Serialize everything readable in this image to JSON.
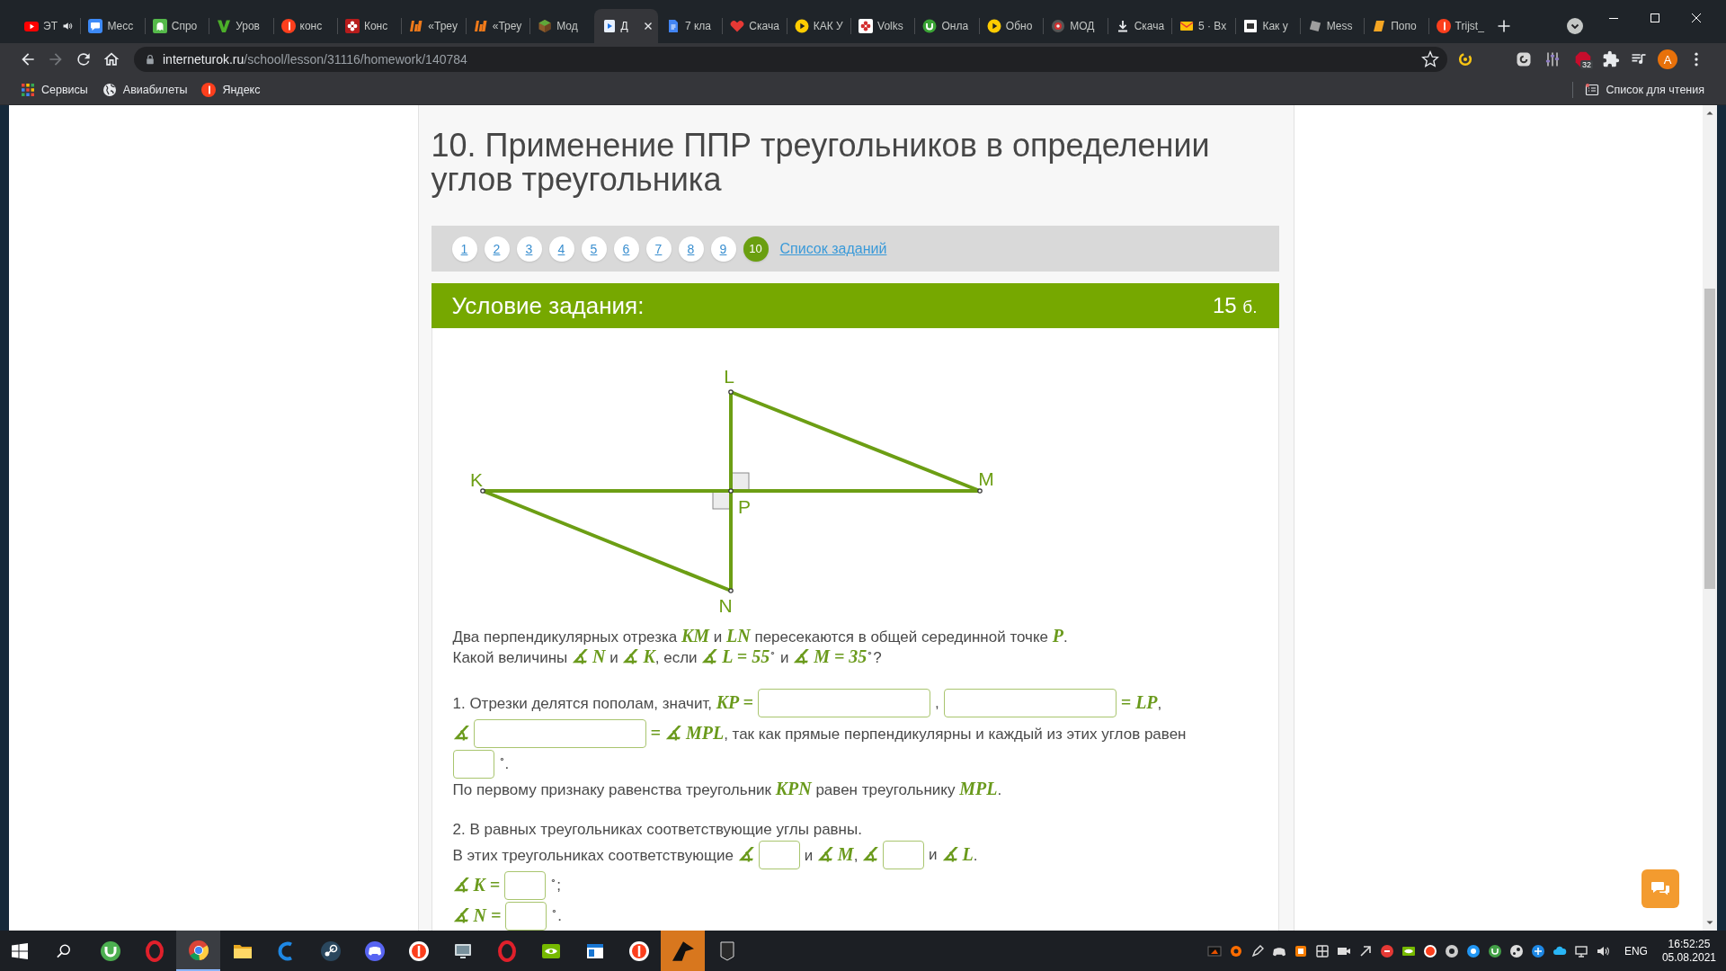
{
  "browser": {
    "tabs": [
      {
        "title": "ЭТ",
        "audio": true,
        "selected": false
      },
      {
        "title": "Месс",
        "audio": false,
        "selected": false
      },
      {
        "title": "Спро",
        "audio": false,
        "selected": false
      },
      {
        "title": "Уров",
        "audio": false,
        "selected": false
      },
      {
        "title": "конс",
        "audio": false,
        "selected": false
      },
      {
        "title": "Конс",
        "audio": false,
        "selected": false
      },
      {
        "title": "«Треу",
        "audio": false,
        "selected": false
      },
      {
        "title": "«Треу",
        "audio": false,
        "selected": false
      },
      {
        "title": "Мод",
        "audio": false,
        "selected": false
      },
      {
        "title": "Д",
        "audio": false,
        "selected": true
      },
      {
        "title": "7 кла",
        "audio": false,
        "selected": false
      },
      {
        "title": "Скача",
        "audio": false,
        "selected": false
      },
      {
        "title": "КАК У",
        "audio": false,
        "selected": false
      },
      {
        "title": "Volks",
        "audio": false,
        "selected": false
      },
      {
        "title": "Онла",
        "audio": false,
        "selected": false
      },
      {
        "title": "Обно",
        "audio": false,
        "selected": false
      },
      {
        "title": "МОД",
        "audio": false,
        "selected": false
      },
      {
        "title": "Скача",
        "audio": false,
        "selected": false
      },
      {
        "title": "5 · Вх",
        "audio": false,
        "selected": false
      },
      {
        "title": "Как у",
        "audio": false,
        "selected": false
      },
      {
        "title": "Mess",
        "audio": false,
        "selected": false
      },
      {
        "title": "Попо",
        "audio": false,
        "selected": false
      },
      {
        "title": "Trijst_",
        "audio": false,
        "selected": false
      }
    ],
    "nav": {
      "back_disabled": false,
      "forward_disabled": true
    },
    "url_host": "interneturok.ru",
    "url_path": "/school/lesson/31116/homework/140784",
    "extension_badge": "32",
    "profile_initial": "A",
    "bookmarks": [
      {
        "label": "Сервисы"
      },
      {
        "label": "Авиабилеты"
      },
      {
        "label": "Яндекс"
      }
    ],
    "reading_list": "Список для чтения"
  },
  "page": {
    "title": "10. Применение ППР треугольников в определении углов треугольника",
    "task_nav": [
      {
        "label": "1",
        "selected": false
      },
      {
        "label": "2",
        "selected": false
      },
      {
        "label": "3",
        "selected": false
      },
      {
        "label": "4",
        "selected": false
      },
      {
        "label": "5",
        "selected": false
      },
      {
        "label": "6",
        "selected": false
      },
      {
        "label": "7",
        "selected": false
      },
      {
        "label": "8",
        "selected": false
      },
      {
        "label": "9",
        "selected": false
      },
      {
        "label": "10",
        "selected": true
      }
    ],
    "task_list_link": "Список заданий",
    "task_header": {
      "title": "Условие задания:",
      "points": "15",
      "points_unit": "б."
    },
    "figure": {
      "points": [
        {
          "label": "L"
        },
        {
          "label": "K"
        },
        {
          "label": "M"
        },
        {
          "label": "P"
        },
        {
          "label": "N"
        }
      ]
    },
    "statement": [
      "Два перпендикулярных отрезка *KM* и *LN* пересекаются в общей серединной точке *P*.",
      "Какой величины *∡ N* и *∡ K*, если *∡ L = 55*$^{∘}$ и *∡ M = 35*$^{∘}$?"
    ],
    "questions": [
      {
        "lines": [
          {
            "parts": [
              {
                "kind": "text",
                "text": "1. Отрезки делятся пополам, значит, *KP =*"
              },
              {
                "kind": "long_field"
              },
              {
                "kind": "text",
                "text": ","
              },
              {
                "kind": "long_field"
              },
              {
                "kind": "text",
                "text": "*= LP*,"
              }
            ]
          },
          {
            "parts": [
              {
                "kind": "text",
                "text": "*∡*"
              },
              {
                "kind": "long_field"
              },
              {
                "kind": "text",
                "text": "*= ∡ MPL*, так как прямые перпендикулярны и каждый из этих углов равен"
              }
            ]
          },
          {
            "parts": [
              {
                "kind": "short_field"
              },
              {
                "kind": "text",
                "text": "$^{∘}$."
              }
            ]
          },
          {
            "parts": [
              {
                "kind": "text",
                "text": "По первому признаку равенства треугольник *KPN* равен треугольнику *MPL*."
              }
            ]
          }
        ]
      },
      {
        "lines": [
          {
            "parts": [
              {
                "kind": "text",
                "text": "2. В равных треугольниках соответствующие углы равны."
              }
            ]
          },
          {
            "parts": [
              {
                "kind": "text",
                "text": "В этих треугольниках соответствующие *∡*"
              },
              {
                "kind": "short_field"
              },
              {
                "kind": "text",
                "text": "и *∡ M*, *∡*"
              },
              {
                "kind": "short_field"
              },
              {
                "kind": "text",
                "text": "и"
              },
              {
                "kind": "text",
                "text": "*∡ L*."
              }
            ]
          },
          {
            "parts": [
              {
                "kind": "text",
                "text": "*∡ K =*"
              },
              {
                "kind": "short_field"
              },
              {
                "kind": "text",
                "text": "$^{∘}$;"
              }
            ]
          },
          {
            "parts": [
              {
                "kind": "text",
                "text": "*∡ N =*"
              },
              {
                "kind": "short_field"
              },
              {
                "kind": "text",
                "text": "$^{∘}$."
              }
            ]
          }
        ]
      }
    ]
  },
  "taskbar": {
    "apps": [
      {
        "selected": false,
        "attention": false
      },
      {
        "selected": false,
        "attention": false
      },
      {
        "selected": true,
        "attention": false
      },
      {
        "selected": false,
        "attention": false
      },
      {
        "selected": false,
        "attention": false
      },
      {
        "selected": false,
        "attention": false
      },
      {
        "selected": false,
        "attention": false
      },
      {
        "selected": false,
        "attention": false
      },
      {
        "selected": false,
        "attention": false
      },
      {
        "selected": false,
        "attention": false
      },
      {
        "selected": false,
        "attention": false
      },
      {
        "selected": false,
        "attention": false
      },
      {
        "selected": false,
        "attention": false
      },
      {
        "selected": false,
        "attention": true
      },
      {
        "selected": false,
        "attention": false
      }
    ],
    "language": "ENG",
    "time": "16:52:25",
    "date": "05.08.2021"
  }
}
